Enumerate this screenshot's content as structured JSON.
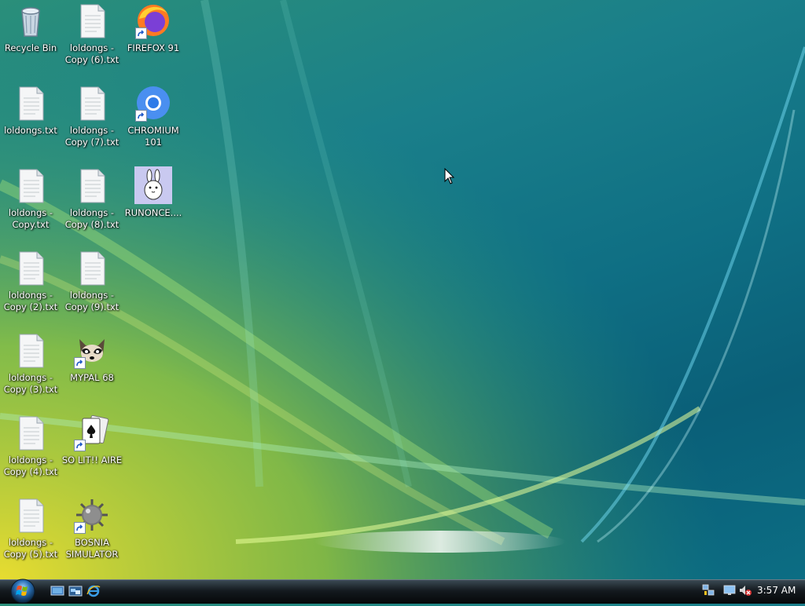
{
  "desktop": {
    "icons": [
      {
        "label": "Recycle Bin",
        "icon": "recycle-bin-icon"
      },
      {
        "label": "loldongs - Copy (6).txt",
        "icon": "text-file-icon"
      },
      {
        "label": "FIREFOX 91",
        "icon": "firefox-icon"
      },
      {
        "label": "loldongs.txt",
        "icon": "text-file-icon"
      },
      {
        "label": "loldongs - Copy (7).txt",
        "icon": "text-file-icon"
      },
      {
        "label": "CHROMIUM 101",
        "icon": "chromium-icon"
      },
      {
        "label": "loldongs - Copy.txt",
        "icon": "text-file-icon"
      },
      {
        "label": "loldongs - Copy (8).txt",
        "icon": "text-file-icon"
      },
      {
        "label": "RUNONCE....",
        "icon": "bunny-icon"
      },
      {
        "label": "loldongs - Copy (2).txt",
        "icon": "text-file-icon"
      },
      {
        "label": "loldongs - Copy (9).txt",
        "icon": "text-file-icon"
      },
      {
        "label": "loldongs - Copy (3).txt",
        "icon": "text-file-icon"
      },
      {
        "label": "MYPAL 68",
        "icon": "raccoon-icon"
      },
      {
        "label": "loldongs - Copy (4).txt",
        "icon": "text-file-icon"
      },
      {
        "label": "SO LIT!! AIRE",
        "icon": "solitaire-cards-icon"
      },
      {
        "label": "loldongs - Copy (5).txt",
        "icon": "text-file-icon"
      },
      {
        "label": "BOSNIA SIMULATOR",
        "icon": "mine-icon"
      }
    ]
  },
  "taskbar": {
    "quick_launch": [
      "show-desktop-icon",
      "switch-windows-icon",
      "internet-explorer-icon"
    ],
    "tray": [
      "network-icon",
      "monitor-icon",
      "volume-muted-icon"
    ],
    "clock": "3:57 AM"
  },
  "colors": {
    "wallpaper_top": "#2a8f7a",
    "wallpaper_bottom": "#0c6f85",
    "glow_yellow": "#e6d838",
    "taskbar": "#141a1f"
  }
}
